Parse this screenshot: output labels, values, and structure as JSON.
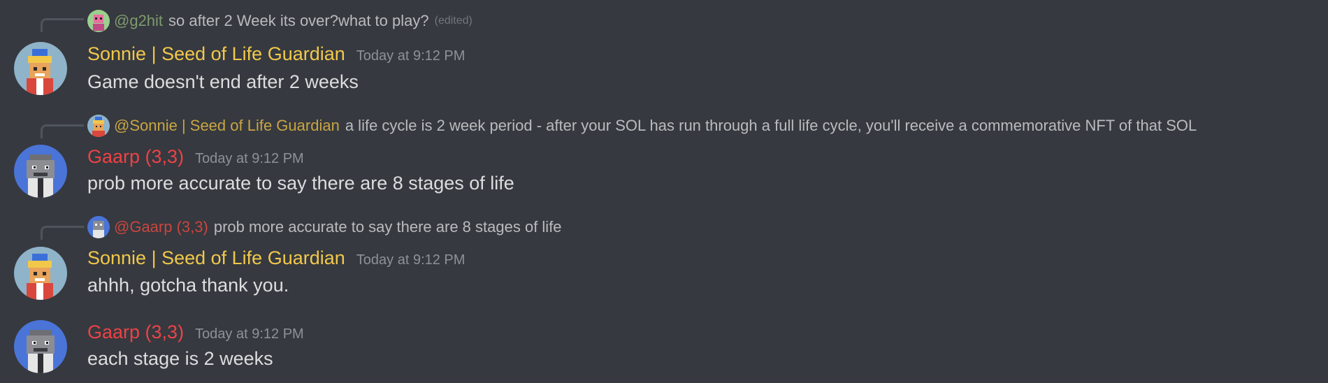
{
  "colors": {
    "background": "#36393f",
    "sonnie": "#f1c84b",
    "gaarp": "#ed4245",
    "g2hit": "#7e9b6e",
    "sonnie_mention": "#c9a543",
    "gaarp_mention": "#c9463f",
    "text": "#dcddde",
    "muted": "#8e9297"
  },
  "messages": [
    {
      "reply": {
        "avatar_icon": "g2hit-avatar-icon",
        "mention": "@g2hit",
        "text": "so after 2 Week its over?what to play?",
        "edited": "(edited)"
      },
      "avatar_icon": "sonnie-avatar-icon",
      "username": "Sonnie | Seed of Life Guardian",
      "timestamp": "Today at 9:12 PM",
      "content": "Game doesn't end after 2 weeks"
    },
    {
      "reply": {
        "avatar_icon": "sonnie-avatar-icon",
        "mention": "@Sonnie | Seed of Life Guardian",
        "text": "a life cycle is 2 week period - after your SOL has run through a full life cycle, you'll receive a commemorative NFT of that SOL"
      },
      "avatar_icon": "gaarp-avatar-icon",
      "username": "Gaarp (3,3)",
      "timestamp": "Today at 9:12 PM",
      "content": "prob more accurate to say there are 8 stages of life"
    },
    {
      "reply": {
        "avatar_icon": "gaarp-avatar-icon",
        "mention": "@Gaarp (3,3)",
        "text": "prob more accurate to say there are 8 stages of life"
      },
      "avatar_icon": "sonnie-avatar-icon",
      "username": "Sonnie | Seed of Life Guardian",
      "timestamp": "Today at 9:12 PM",
      "content": "ahhh, gotcha thank you."
    },
    {
      "avatar_icon": "gaarp-avatar-icon",
      "username": "Gaarp (3,3)",
      "timestamp": "Today at 9:12 PM",
      "content": "each stage is 2 weeks"
    }
  ]
}
